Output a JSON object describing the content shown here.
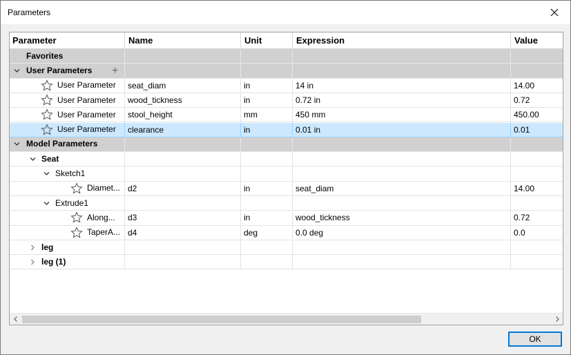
{
  "window": {
    "title": "Parameters"
  },
  "columns": [
    "Parameter",
    "Name",
    "Unit",
    "Expression",
    "Value"
  ],
  "rows": [
    {
      "kind": "group",
      "level": 0,
      "chevron": "none",
      "label": "Favorites"
    },
    {
      "kind": "group",
      "level": 0,
      "chevron": "down",
      "label": "User Parameters",
      "add": "+"
    },
    {
      "kind": "param",
      "level": 1,
      "star": true,
      "label": "User Parameter",
      "name": "seat_diam",
      "unit": "in",
      "expression": "14 in",
      "value": "14.00"
    },
    {
      "kind": "param",
      "level": 1,
      "star": true,
      "label": "User Parameter",
      "name": "wood_tickness",
      "unit": "in",
      "expression": "0.72 in",
      "value": "0.72"
    },
    {
      "kind": "param",
      "level": 1,
      "star": true,
      "label": "User Parameter",
      "name": "stool_height",
      "unit": "mm",
      "expression": "450 mm",
      "value": "450.00"
    },
    {
      "kind": "param",
      "level": 1,
      "star": true,
      "selected": true,
      "label": "User Parameter",
      "name": "clearance",
      "unit": "in",
      "expression": "0.01 in",
      "value": "0.01"
    },
    {
      "kind": "group",
      "level": 0,
      "chevron": "down",
      "label": "Model Parameters"
    },
    {
      "kind": "node",
      "level": 1,
      "chevron": "down",
      "bold": true,
      "label": "Seat"
    },
    {
      "kind": "node",
      "level": 2,
      "chevron": "down",
      "label": "Sketch1"
    },
    {
      "kind": "param",
      "level": 4,
      "star": true,
      "label": "Diamet...",
      "name": "d2",
      "unit": "in",
      "expression": "seat_diam",
      "value": "14.00"
    },
    {
      "kind": "node",
      "level": 2,
      "chevron": "down",
      "label": "Extrude1"
    },
    {
      "kind": "param",
      "level": 4,
      "star": true,
      "label": "Along...",
      "name": "d3",
      "unit": "in",
      "expression": "wood_tickness",
      "value": "0.72"
    },
    {
      "kind": "param",
      "level": 4,
      "star": true,
      "label": "TaperA...",
      "name": "d4",
      "unit": "deg",
      "expression": "0.0 deg",
      "value": "0.0"
    },
    {
      "kind": "node",
      "level": 1,
      "chevron": "right",
      "bold": true,
      "label": "leg"
    },
    {
      "kind": "node",
      "level": 1,
      "chevron": "right",
      "bold": true,
      "label": "leg (1)"
    }
  ],
  "buttons": {
    "ok": "OK"
  },
  "colors": {
    "selection": "#cce8ff",
    "group": "#d0d0d0",
    "accent": "#0078d7"
  }
}
